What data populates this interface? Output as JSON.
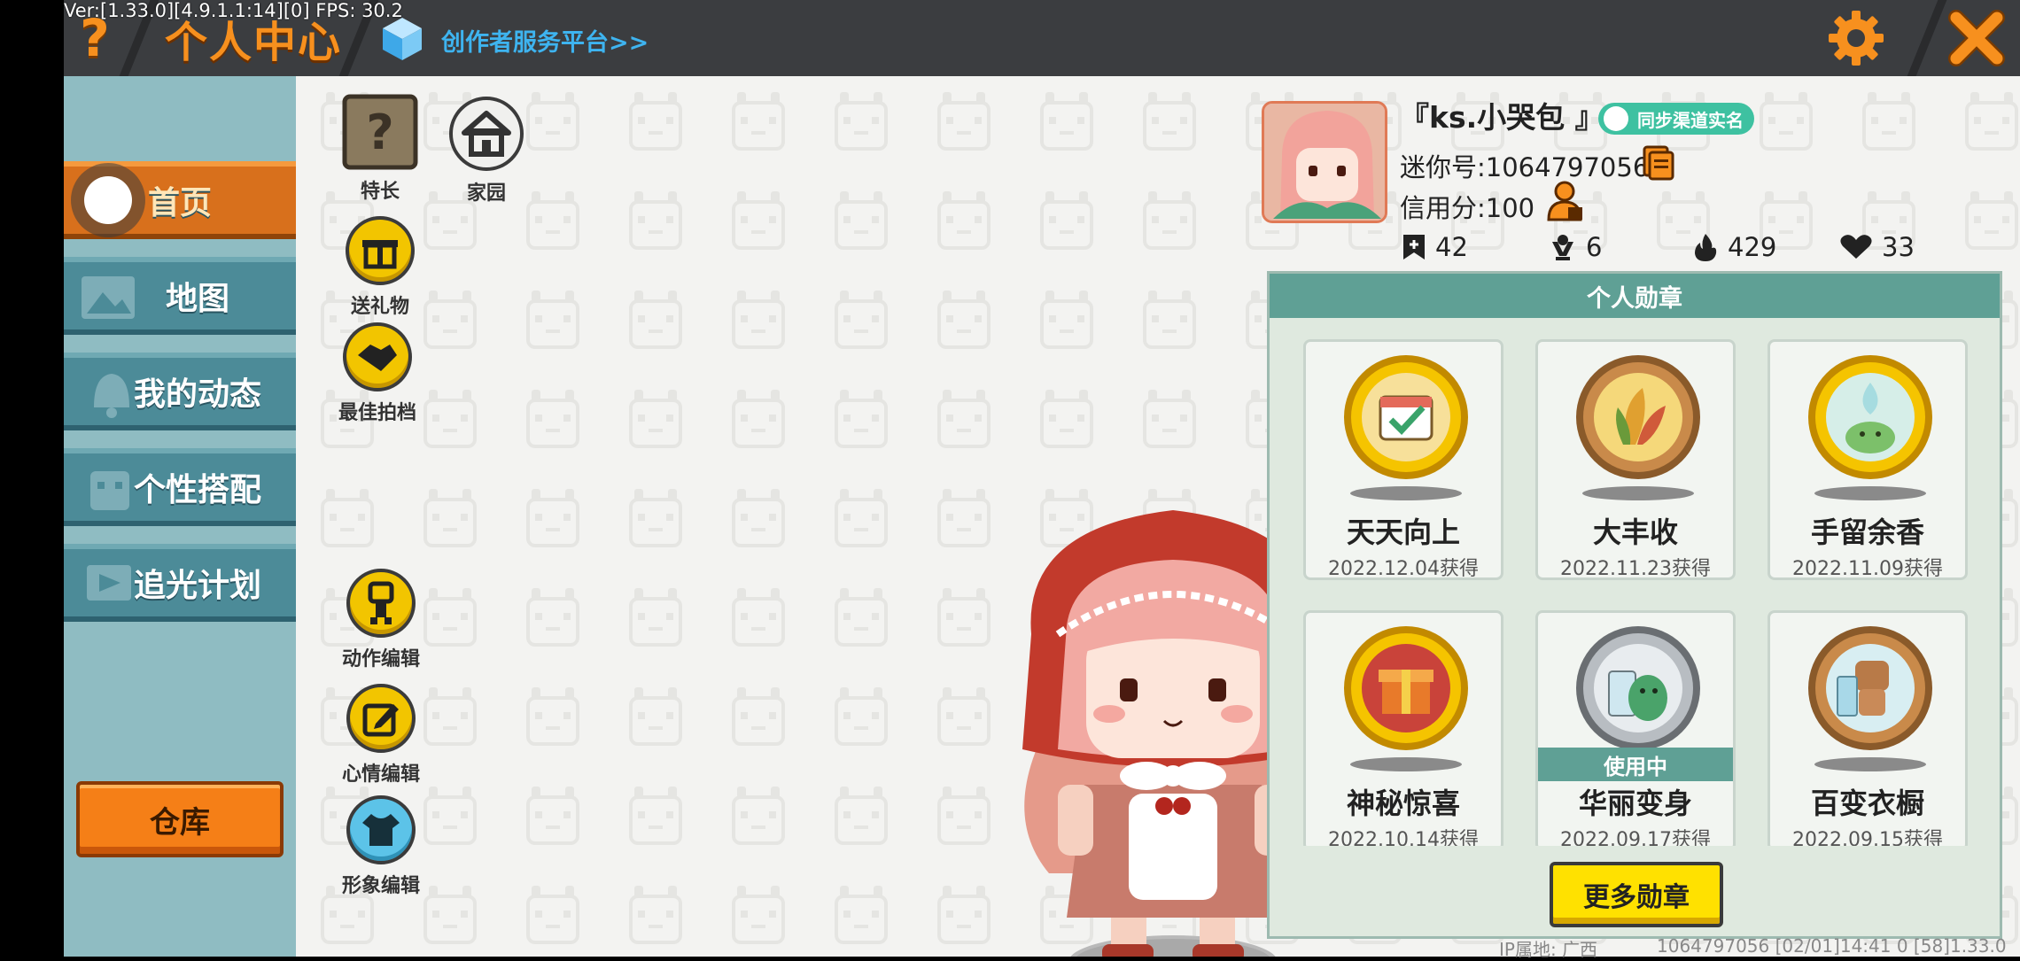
{
  "debug": {
    "text": "Ver:[1.33.0][4.9.1.1:14][0] FPS: 30.2"
  },
  "header": {
    "help_glyph": "?",
    "title": "个人中心",
    "creator_link": "创作者服务平台>>",
    "colors": {
      "bar": "#3b3d40",
      "accent": "#f7901e"
    }
  },
  "sidebar": {
    "items": [
      {
        "label": "首页",
        "active": true,
        "icon": "home-icon"
      },
      {
        "label": "地图",
        "active": false,
        "icon": "map-icon"
      },
      {
        "label": "我的动态",
        "active": false,
        "icon": "bell-icon"
      },
      {
        "label": "个性搭配",
        "active": false,
        "icon": "outfit-icon"
      },
      {
        "label": "追光计划",
        "active": false,
        "icon": "spotlight-icon"
      }
    ],
    "warehouse_label": "仓库"
  },
  "tools": {
    "specialty": "特长",
    "homeland": "家园",
    "send_gift": "送礼物",
    "best_photo": "最佳拍档",
    "action_edit": "动作编辑",
    "mood_edit": "心情编辑",
    "avatar_edit": "形象编辑"
  },
  "profile": {
    "nickname": "『ks.小哭包 』",
    "realname_badge": "同步渠道实名",
    "mini_id": "迷你号:1064797056",
    "credit": "信用分:100",
    "stats": [
      {
        "icon": "bookmark-plus-icon",
        "value": "42"
      },
      {
        "icon": "trophy-icon",
        "value": "6"
      },
      {
        "icon": "flame-icon",
        "value": "429"
      },
      {
        "icon": "heart-icon",
        "value": "33"
      }
    ]
  },
  "medals": {
    "title": "个人勋章",
    "items": [
      {
        "name": "天天向上",
        "date": "2022.12.04获得",
        "ring": "gold",
        "in_use": false
      },
      {
        "name": "大丰收",
        "date": "2022.11.23获得",
        "ring": "bronze",
        "in_use": false
      },
      {
        "name": "手留余香",
        "date": "2022.11.09获得",
        "ring": "gold",
        "in_use": false
      },
      {
        "name": "神秘惊喜",
        "date": "2022.10.14获得",
        "ring": "gold",
        "in_use": false
      },
      {
        "name": "华丽变身",
        "date": "2022.09.17获得",
        "ring": "silver",
        "in_use": true
      },
      {
        "name": "百变衣橱",
        "date": "2022.09.15获得",
        "ring": "bronze",
        "in_use": false
      }
    ],
    "in_use_label": "使用中",
    "more_label": "更多勋章"
  },
  "footer": {
    "ip": "IP属地: 广西",
    "text": "1064797056   [02/01]14:41 0   [58]1.33.0"
  }
}
